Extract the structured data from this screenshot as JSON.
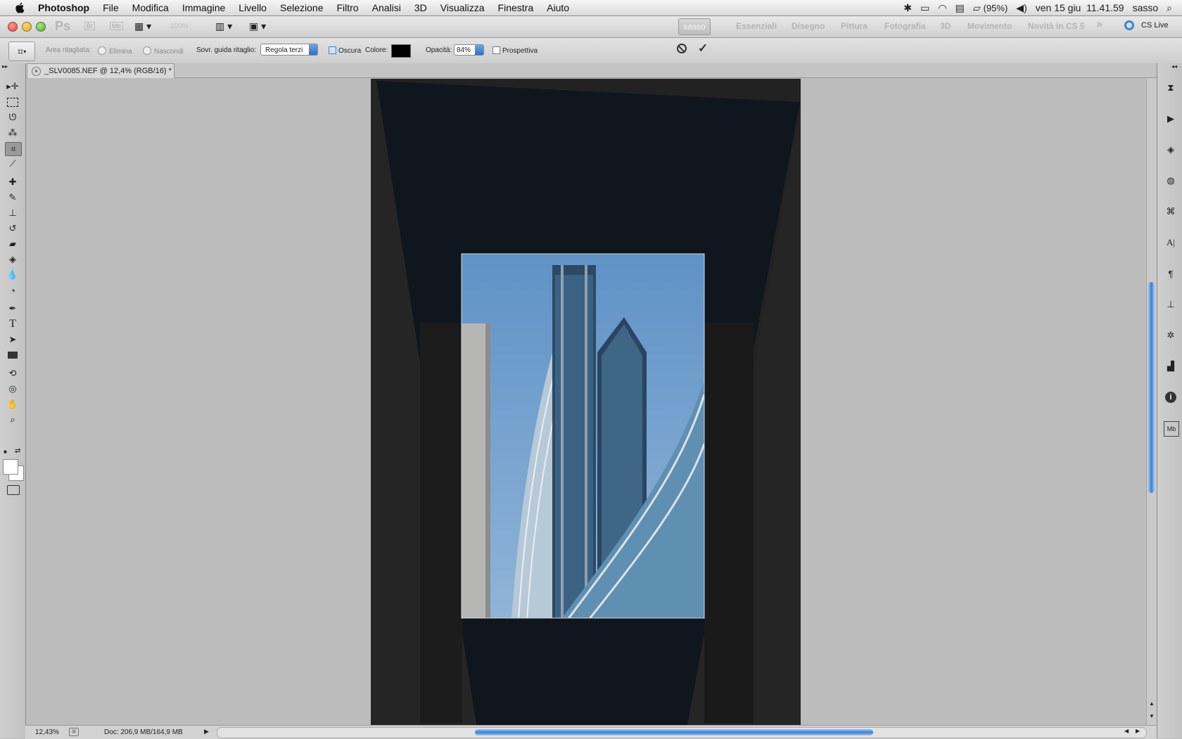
{
  "menubar": {
    "app_name": "Photoshop",
    "items": [
      "File",
      "Modifica",
      "Immagine",
      "Livello",
      "Selezione",
      "Filtro",
      "Analisi",
      "3D",
      "Visualizza",
      "Finestra",
      "Aiuto"
    ],
    "battery": "(95%)",
    "clock": "ven 15 giu  11.41.59",
    "user": "sasso"
  },
  "appbar": {
    "ps_logo": "Ps",
    "bridge": "Br",
    "minibridge": "Mb",
    "zoom_value": "100%",
    "workspaces": [
      "sasso",
      "Essenziali",
      "Disegno",
      "Pittura",
      "Fotografia",
      "3D",
      "Movimento",
      "Novità in CS 5"
    ],
    "more": "»",
    "cs_live": "CS Live"
  },
  "options": {
    "area_label": "Area ritagliata:",
    "elimina": "Elimina",
    "nascondi": "Nascondi",
    "overlay_label": "Sovr. guida ritaglio:",
    "overlay_value": "Regola terzi",
    "oscura": "Oscura",
    "colore": "Colore:",
    "color_value": "#000000",
    "opacita": "Opacità:",
    "opacity_value": "84%",
    "prospettiva": "Prospettiva"
  },
  "document": {
    "tab_title": "_SLV0085.NEF @ 12,4% (RGB/16) *"
  },
  "status": {
    "zoom": "12,43%",
    "doc_info": "Doc: 206,9 MB/164,9 MB"
  },
  "colors": {
    "sky": "#6f9cc9",
    "crop_shield": "#232323",
    "accent_blue": "#3a7fd6"
  },
  "tools": [
    "move-icon",
    "marquee-icon",
    "lasso-icon",
    "quick-select-icon",
    "crop-icon",
    "eyedropper-icon",
    "healing-icon",
    "brush-icon",
    "stamp-icon",
    "history-brush-icon",
    "eraser-icon",
    "bucket-icon",
    "blur-icon",
    "dodge-icon",
    "pen-icon",
    "type-icon",
    "path-select-icon",
    "rectangle-icon",
    "3d-rotate-icon",
    "3d-orbit-icon",
    "hand-icon",
    "zoom-icon"
  ],
  "dock": [
    "history-icon",
    "actions-icon",
    "layers-icon",
    "channels-icon",
    "paths-icon",
    "character-icon",
    "paragraph-icon",
    "clone-source-icon",
    "tool-presets-icon",
    "histogram-icon",
    "info-icon",
    "mini-bridge-icon"
  ]
}
